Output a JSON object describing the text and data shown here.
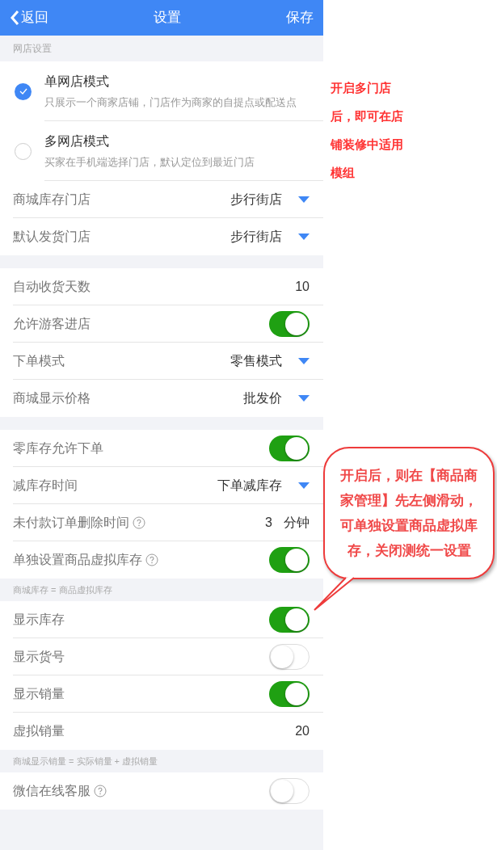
{
  "header": {
    "back": "返回",
    "title": "设置",
    "save": "保存"
  },
  "sections": [
    {
      "label": "网店设置",
      "rows": [
        {
          "kind": "radio",
          "title": "单网店模式",
          "description": "只展示一个商家店铺，门店作为商家的自提点或配送点",
          "selected": true
        },
        {
          "kind": "radio",
          "title": "多网店模式",
          "description": "买家在手机端选择门店，默认定位到最近门店",
          "selected": false
        },
        {
          "kind": "select",
          "label": "商城库存门店",
          "value": "步行街店"
        },
        {
          "kind": "select",
          "label": "默认发货门店",
          "value": "步行街店"
        }
      ]
    },
    {
      "rows": [
        {
          "kind": "value",
          "label": "自动收货天数",
          "value": "10"
        },
        {
          "kind": "toggle",
          "label": "允许游客进店",
          "on": true
        },
        {
          "kind": "select",
          "label": "下单模式",
          "value": "零售模式"
        },
        {
          "kind": "select",
          "label": "商城显示价格",
          "value": "批发价"
        }
      ]
    },
    {
      "rows": [
        {
          "kind": "toggle",
          "label": "零库存允许下单",
          "on": true
        },
        {
          "kind": "select",
          "label": "减库存时间",
          "value": "下单减库存"
        },
        {
          "kind": "value",
          "label": "未付款订单删除时间",
          "help": true,
          "value": "3",
          "unit": "分钟"
        },
        {
          "kind": "toggle",
          "label": "单独设置商品虚拟库存",
          "help": true,
          "on": true
        }
      ],
      "note": "商城库存 = 商品虚拟库存"
    },
    {
      "rows": [
        {
          "kind": "toggle",
          "label": "显示库存",
          "on": true
        },
        {
          "kind": "toggle",
          "label": "显示货号",
          "on": false
        },
        {
          "kind": "toggle",
          "label": "显示销量",
          "on": true
        },
        {
          "kind": "value",
          "label": "虚拟销量",
          "value": "20"
        }
      ],
      "note": "商城显示销量 = 实际销量 + 虚拟销量"
    },
    {
      "rows": [
        {
          "kind": "toggle",
          "label": "微信在线客服",
          "help": true,
          "on": false
        }
      ]
    }
  ],
  "annotations": [
    {
      "kind": "plain",
      "text": "开启多门店后，即可在店铺装修中适用模组"
    },
    {
      "kind": "callout",
      "text": "开启后，则在【商品商家管理】先左侧滑动，可单独设置商品虚拟库存，关闭测统一设置"
    }
  ]
}
